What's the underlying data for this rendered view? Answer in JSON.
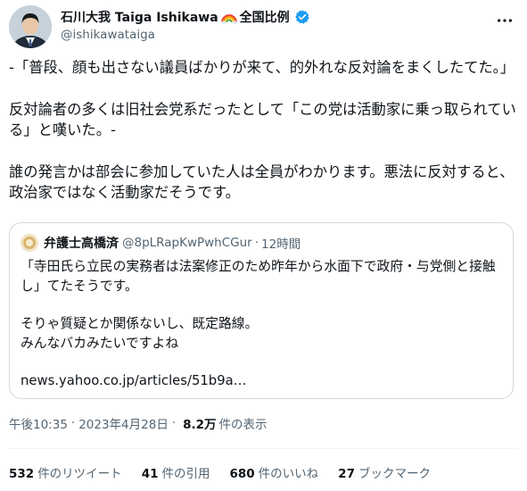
{
  "author": {
    "display_name": "石川大我 Taiga Ishikawa",
    "name_suffix": "全国比例",
    "handle": "@ishikawataiga",
    "icons": [
      "rainbow-icon",
      "verified-icon",
      "more-icon"
    ],
    "verified_color": "#1d9bf0"
  },
  "tweet": {
    "paragraphs": [
      "-「普段、顔も出さない議員ばかりが来て、的外れな反対論をまくしたてた。」",
      "反対論者の多くは旧社会党系だったとして「この党は活動家に乗っ取られている」と嘆いた。-",
      "誰の発言かは部会に参加していた人は全員がわかります。悪法に反対すると、政治家ではなく活動家だそうです。"
    ]
  },
  "quote": {
    "name": "弁護士高橋済",
    "handle": "@8pLRapKwPwhCGur",
    "separator": "·",
    "time": "12時間",
    "line1": "「寺田氏ら立民の実務者は法案修正のため昨年から水面下で政府・与党側と接触し」てたそうです。",
    "line2": "そりゃ質疑とか関係ないし、既定路線。",
    "line3": "みんなバカみたいですよね",
    "link": "news.yahoo.co.jp/articles/51b9a…"
  },
  "meta": {
    "time": "午後10:35",
    "dot": "·",
    "date": "2023年4月28日",
    "views_count": "8.2万",
    "views_label": "件の表示"
  },
  "stats": {
    "retweets": {
      "count": "532",
      "label": "件のリツイート"
    },
    "quotes": {
      "count": "41",
      "label": "件の引用"
    },
    "likes": {
      "count": "680",
      "label": "件のいいね"
    },
    "bookmarks": {
      "count": "27",
      "label": "ブックマーク"
    }
  }
}
